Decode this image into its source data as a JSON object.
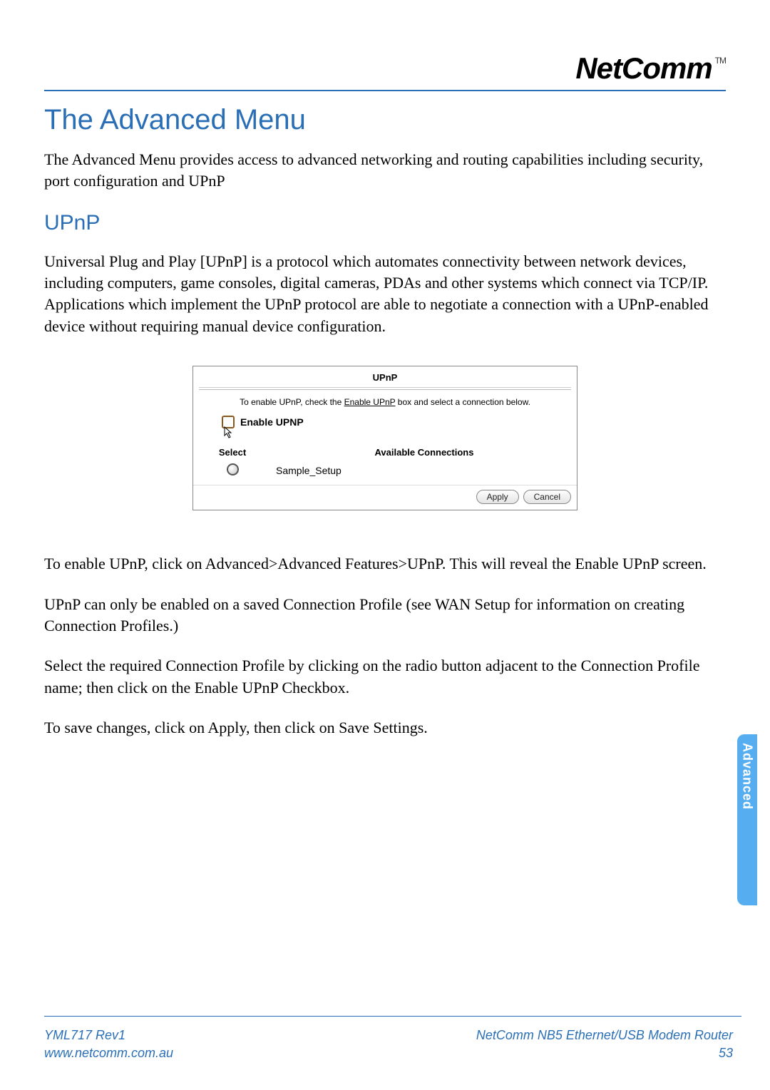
{
  "brand": {
    "name": "NetComm",
    "tm": "TM"
  },
  "title": "The Advanced Menu",
  "intro": "The Advanced Menu provides access to advanced networking and routing capabilities including security, port configuration and UPnP",
  "section": {
    "heading": "UPnP",
    "para1": "Universal Plug and Play [UPnP] is a protocol which automates connectivity between network devices, including computers, game consoles, digital cameras, PDAs and other systems which connect via TCP/IP.  Applications which implement the UPnP protocol are able to negotiate a connection with a UPnP-enabled device without requiring manual device configuration."
  },
  "panel": {
    "title": "UPnP",
    "instruction_pre": "To enable UPnP, check the ",
    "instruction_ul": "Enable UPnP",
    "instruction_post": " box and select a connection below.",
    "enable_label": "Enable UPNP",
    "col_select": "Select",
    "col_available": "Available Connections",
    "connections": [
      {
        "name": "Sample_Setup"
      }
    ],
    "apply": "Apply",
    "cancel": "Cancel"
  },
  "after_panel": {
    "p1": "To enable UPnP, click on Advanced>Advanced Features>UPnP.  This will reveal the Enable UPnP screen.",
    "p2": "UPnP can only be enabled on a saved Connection Profile (see WAN Setup for information on creating Connection Profiles.)",
    "p3": "Select the required Connection Profile by clicking on the radio button adjacent to the Connection Profile name; then click on the Enable UPnP Checkbox.",
    "p4": "To save changes, click on Apply, then click on Save Settings."
  },
  "side_tab": "Advanced",
  "footer": {
    "doc_id": "YML717 Rev1",
    "url": "www.netcomm.com.au",
    "product": "NetComm NB5 Ethernet/USB Modem Router",
    "page": "53"
  }
}
